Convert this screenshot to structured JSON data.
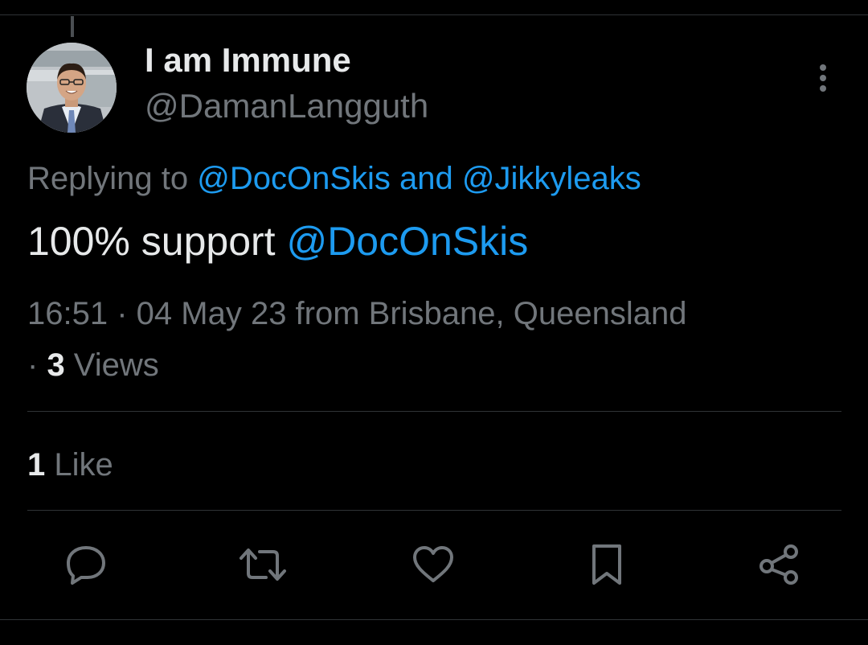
{
  "tweet": {
    "author": {
      "display_name": "I am Immune",
      "handle": "@DamanLangguth"
    },
    "reply_prefix": "Replying to ",
    "reply_to_1": "@DocOnSkis",
    "reply_and": " and ",
    "reply_to_2": "@Jikkyleaks",
    "text_body": "100% support ",
    "text_mention": "@DocOnSkis",
    "time": "16:51",
    "separator": " · ",
    "date": "04 May 23",
    "location_text": " from Brisbane, Queensland",
    "views_separator": "· ",
    "views_count": "3",
    "views_label": " Views",
    "likes_count": "1",
    "likes_label": " Like"
  },
  "actions": {
    "icons": [
      "reply-icon",
      "retweet-icon",
      "like-icon",
      "bookmark-icon",
      "share-icon"
    ]
  },
  "colors": {
    "background": "#000000",
    "primary_text": "#e7e9ea",
    "secondary_text": "#71767b",
    "link": "#1d9bf0",
    "divider": "#2f3336"
  }
}
